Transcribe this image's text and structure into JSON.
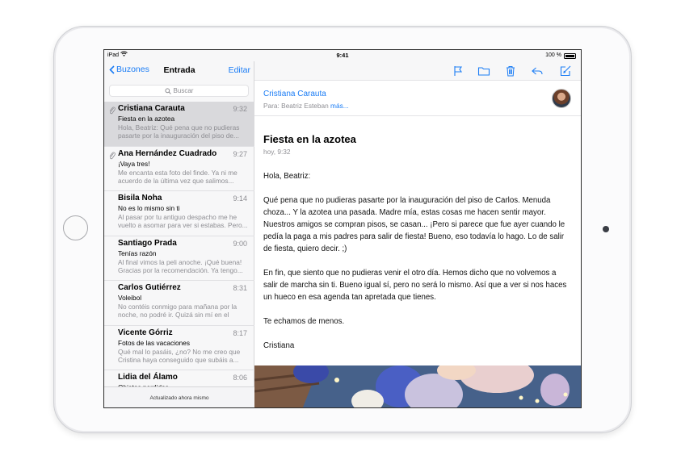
{
  "status": {
    "device": "iPad",
    "time": "9:41",
    "battery": "100 %",
    "battery_level": 1.0
  },
  "mailbox_nav": {
    "back_label": "Buzones",
    "title": "Entrada",
    "edit_label": "Editar"
  },
  "search": {
    "placeholder": "Buscar"
  },
  "messages": [
    {
      "sender": "Cristiana Carauta",
      "time": "9:32",
      "subject": "Fiesta en la azotea",
      "preview": "Hola, Beatriz: Qué pena que no pudieras pasarte por la inauguración del piso de...",
      "attachment": true,
      "selected": true
    },
    {
      "sender": "Ana Hernández Cuadrado",
      "time": "9:27",
      "subject": "¡Vaya tres!",
      "preview": "Me encanta esta foto del finde. Ya ni me acuerdo de la última vez que salimos...",
      "attachment": true,
      "selected": false
    },
    {
      "sender": "Bisila Noha",
      "time": "9:14",
      "subject": "No es lo mismo sin ti",
      "preview": "Al pasar por tu antiguo despacho me he vuelto a asomar para ver si estabas. Pero...",
      "attachment": false,
      "selected": false
    },
    {
      "sender": "Santiago Prada",
      "time": "9:00",
      "subject": "Tenías razón",
      "preview": "Al final vimos la peli anoche. ¡Qué buena! Gracias por la recomendación. Ya tengo...",
      "attachment": false,
      "selected": false
    },
    {
      "sender": "Carlos Gutiérrez",
      "time": "8:31",
      "subject": "Voleibol",
      "preview": "No contéis conmigo para mañana por la noche, no podré ir. Quizá sin mí en el equipo...",
      "attachment": false,
      "selected": false
    },
    {
      "sender": "Vicente Górriz",
      "time": "8:17",
      "subject": "Fotos de las vacaciones",
      "preview": "Qué mal lo pasáis, ¿no? No me creo que Cristina haya conseguido que subáis a...",
      "attachment": false,
      "selected": false
    },
    {
      "sender": "Lidia del Álamo",
      "time": "8:06",
      "subject": "Objetos perdidos",
      "preview": "",
      "attachment": false,
      "selected": false
    }
  ],
  "list_footer": "Actualizado ahora mismo",
  "toolbar": {
    "icons": [
      "flag-icon",
      "folder-icon",
      "trash-icon",
      "reply-icon",
      "compose-icon"
    ],
    "accent": "#1a7cf5"
  },
  "email": {
    "from": "Cristiana Carauta",
    "to_prefix": "Para:",
    "to_name": "Beatriz Esteban",
    "more": "más...",
    "subject": "Fiesta en la azotea",
    "date": "hoy, 9:32",
    "paragraphs": [
      "Hola, Beatriz:",
      "Qué pena que no pudieras pasarte por la inauguración del piso de Carlos. Menuda choza... Y la azotea una pasada. Madre mía, estas cosas me hacen sentir mayor. Nuestros amigos se compran pisos, se casan... ¡Pero si parece que fue ayer cuando le pedía la paga a mis padres para salir de fiesta! Bueno, eso todavía lo hago. Lo de salir de fiesta, quiero decir. ;)",
      "En fin, que siento que no pudieras venir el otro día. Hemos dicho que no volvemos a salir de marcha sin ti. Bueno igual sí, pero no será lo mismo. Así que a ver si nos haces un hueco en esa agenda tan apretada que tienes.",
      "Te echamos de menos.",
      "Cristiana"
    ]
  }
}
